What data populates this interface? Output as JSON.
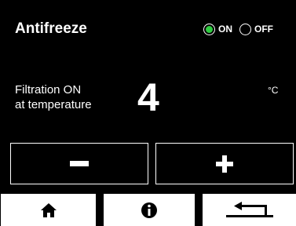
{
  "header": {
    "title": "Antifreeze",
    "on_label": "ON",
    "off_label": "OFF",
    "selected": "ON",
    "on_color": "#2ecc40"
  },
  "main": {
    "description_line1": "Filtration ON",
    "description_line2": "at temperature",
    "value": "4",
    "unit": "°C"
  },
  "controls": {
    "minus_icon": "minus-icon",
    "plus_icon": "plus-icon"
  },
  "nav": {
    "home_icon": "home-icon",
    "info_icon": "info-icon",
    "back_icon": "back-arrow-icon"
  }
}
